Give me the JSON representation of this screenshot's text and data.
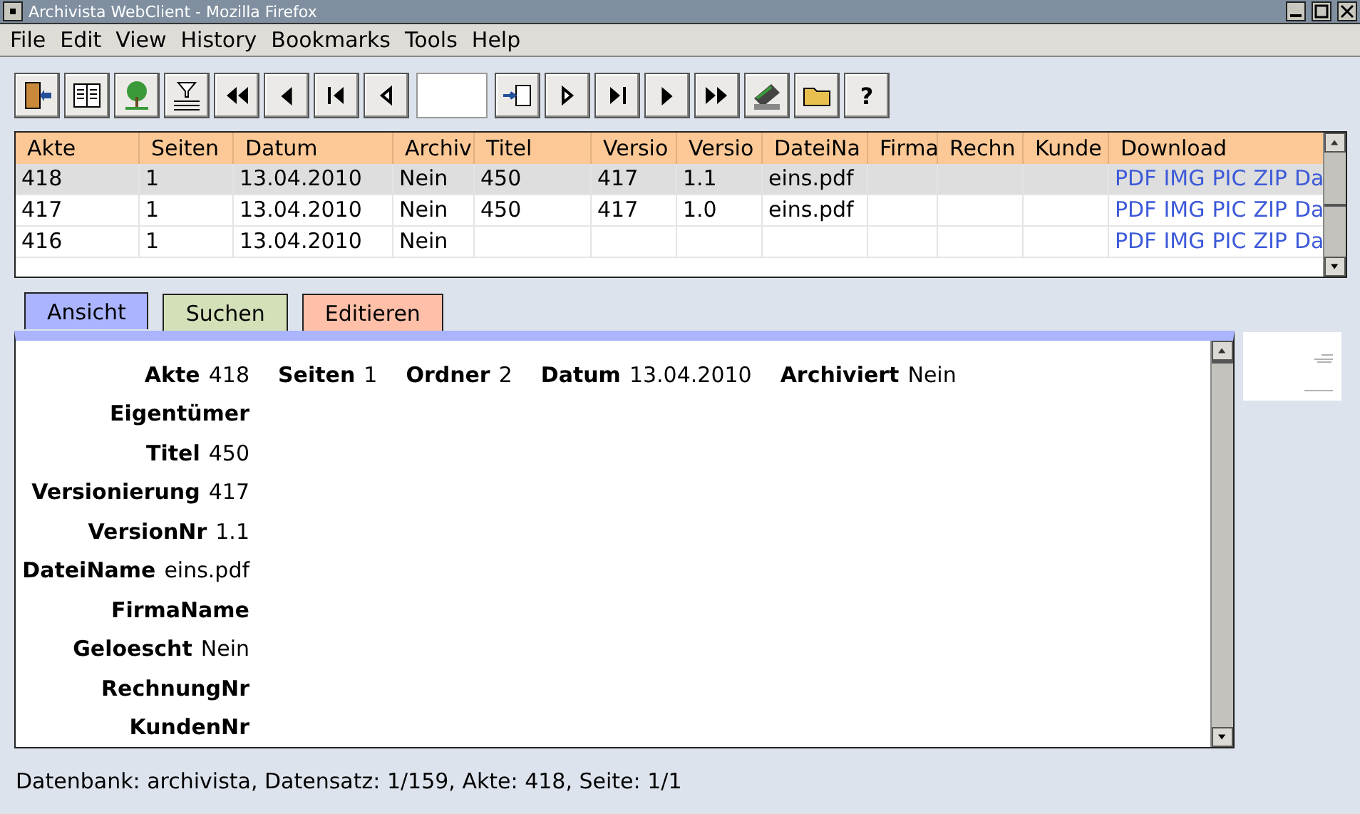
{
  "window": {
    "title": "Archivista WebClient - Mozilla Firefox"
  },
  "menu": [
    {
      "label": "File"
    },
    {
      "label": "Edit"
    },
    {
      "label": "View"
    },
    {
      "label": "History"
    },
    {
      "label": "Bookmarks"
    },
    {
      "label": "Tools"
    },
    {
      "label": "Help"
    }
  ],
  "toolbar": [
    {
      "kind": "exit"
    },
    {
      "kind": "book"
    },
    {
      "kind": "tree"
    },
    {
      "kind": "filter"
    },
    {
      "kind": "fastback"
    },
    {
      "kind": "back"
    },
    {
      "kind": "first"
    },
    {
      "kind": "prev"
    },
    {
      "kind": "field"
    },
    {
      "kind": "import"
    },
    {
      "kind": "next"
    },
    {
      "kind": "last"
    },
    {
      "kind": "forward"
    },
    {
      "kind": "fastforward"
    },
    {
      "kind": "scanner"
    },
    {
      "kind": "folder"
    },
    {
      "kind": "help",
      "text": "?"
    }
  ],
  "table": {
    "columns": [
      "Akte",
      "Seiten",
      "Datum",
      "Archiv",
      "Titel",
      "Versio",
      "Versio",
      "DateiNa",
      "Firma",
      "Rechn",
      "Kunde",
      "Download"
    ],
    "rows": [
      {
        "selected": true,
        "cells": [
          "418",
          "1",
          "13.04.2010",
          "Nein",
          "450",
          "417",
          "1.1",
          "eins.pdf",
          "",
          "",
          "",
          ""
        ],
        "links": [
          "PDF",
          "IMG",
          "PIC",
          "ZIP",
          "Da"
        ]
      },
      {
        "selected": false,
        "cells": [
          "417",
          "1",
          "13.04.2010",
          "Nein",
          "450",
          "417",
          "1.0",
          "eins.pdf",
          "",
          "",
          "",
          ""
        ],
        "links": [
          "PDF",
          "IMG",
          "PIC",
          "ZIP",
          "Da"
        ]
      },
      {
        "selected": false,
        "cells": [
          "416",
          "1",
          "13.04.2010",
          "Nein",
          "",
          "",
          "",
          "",
          "",
          "",
          "",
          ""
        ],
        "links": [
          "PDF",
          "IMG",
          "PIC",
          "ZIP",
          "Da"
        ]
      }
    ]
  },
  "tabs": [
    {
      "label": "Ansicht",
      "selected": true,
      "color": "#aab4ff"
    },
    {
      "label": "Suchen",
      "selected": false,
      "color": "#d4e0b8"
    },
    {
      "label": "Editieren",
      "selected": false,
      "color": "#ffbfa8"
    }
  ],
  "details": [
    [
      {
        "label": "Akte",
        "value": "418"
      },
      {
        "label": "Seiten",
        "value": "1"
      },
      {
        "label": "Ordner",
        "value": "2"
      },
      {
        "label": "Datum",
        "value": "13.04.2010"
      },
      {
        "label": "Archiviert",
        "value": "Nein"
      }
    ],
    [
      {
        "label": "Eigentümer"
      }
    ],
    [
      {
        "label": "Titel",
        "value": "450"
      }
    ],
    [
      {
        "label": "Versionierung",
        "value": "417"
      }
    ],
    [
      {
        "label": "VersionNr",
        "value": "1.1"
      }
    ],
    [
      {
        "label": "DateiName",
        "value": "eins.pdf"
      }
    ],
    [
      {
        "label": "FirmaName"
      }
    ],
    [
      {
        "label": "Geloescht",
        "value": "Nein"
      }
    ],
    [
      {
        "label": "RechnungNr"
      }
    ],
    [
      {
        "label": "KundenNr"
      }
    ]
  ],
  "status_bar": "Datenbank: archivista, Datensatz: 1/159, Akte: 418, Seite: 1/1"
}
